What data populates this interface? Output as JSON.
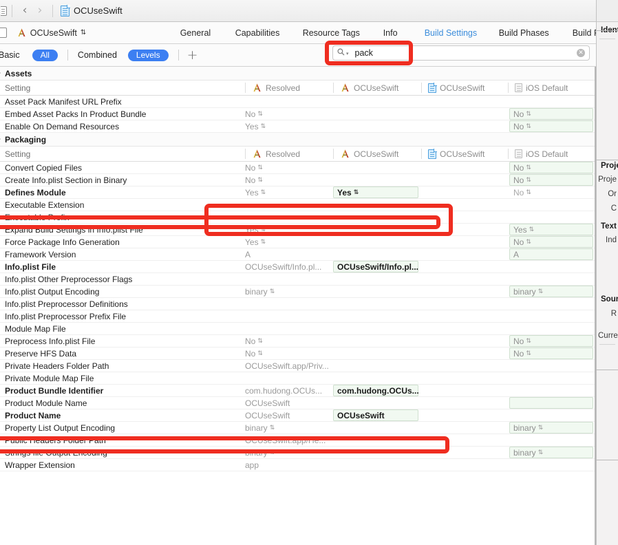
{
  "window": {
    "breadcrumb_project": "OCUseSwift",
    "back_arrow": "‹",
    "forward_arrow": "›"
  },
  "tabbar": {
    "target_name": "OCUseSwift",
    "stepper": "⇅",
    "tabs": [
      {
        "label": "General",
        "active": false
      },
      {
        "label": "Capabilities",
        "active": false
      },
      {
        "label": "Resource Tags",
        "active": false
      },
      {
        "label": "Info",
        "active": false
      },
      {
        "label": "Build Settings",
        "active": true
      },
      {
        "label": "Build Phases",
        "active": false
      },
      {
        "label": "Build Rules",
        "active": false
      }
    ]
  },
  "filterbar": {
    "basic": "Basic",
    "all": "All",
    "combined": "Combined",
    "levels": "Levels",
    "plus": "+"
  },
  "search": {
    "glyph": "⚲",
    "caret": "▾",
    "value": "pack",
    "placeholder": "",
    "clear": "✕"
  },
  "columns": {
    "setting": "Setting",
    "resolved": "Resolved",
    "target": "OCUseSwift",
    "project": "OCUseSwift",
    "ios_default": "iOS Default"
  },
  "groups": [
    {
      "title": "Assets",
      "rows": [
        {
          "name": "Asset Pack Manifest URL Prefix",
          "bold": false,
          "resolved": "",
          "resolved_stepper": false,
          "target": "",
          "project": "",
          "default": "",
          "default_field": false,
          "default_stepper": false
        },
        {
          "name": "Embed Asset Packs In Product Bundle",
          "bold": false,
          "resolved": "No",
          "resolved_stepper": true,
          "target": "",
          "project": "",
          "default": "No",
          "default_field": true,
          "default_stepper": true
        },
        {
          "name": "Enable On Demand Resources",
          "bold": false,
          "resolved": "Yes",
          "resolved_stepper": true,
          "target": "",
          "project": "",
          "default": "No",
          "default_field": true,
          "default_stepper": true
        }
      ]
    },
    {
      "title": "Packaging",
      "rows": [
        {
          "name": "Convert Copied Files",
          "bold": false,
          "resolved": "No",
          "resolved_stepper": true,
          "target": "",
          "project": "",
          "default": "No",
          "default_field": true,
          "default_stepper": true
        },
        {
          "name": "Create Info.plist Section in Binary",
          "bold": false,
          "resolved": "No",
          "resolved_stepper": true,
          "target": "",
          "project": "",
          "default": "No",
          "default_field": true,
          "default_stepper": true
        },
        {
          "name": "Defines Module",
          "bold": true,
          "resolved": "Yes",
          "resolved_stepper": true,
          "target": "Yes",
          "target_stepper": true,
          "target_field": true,
          "project": "",
          "default": "No",
          "default_field": false,
          "default_stepper": true
        },
        {
          "name": "Executable Extension",
          "bold": false,
          "resolved": "",
          "resolved_stepper": false,
          "target": "",
          "project": "",
          "default": "",
          "default_field": false,
          "default_stepper": false
        },
        {
          "name": "Executable Prefix",
          "bold": false,
          "resolved": "",
          "resolved_stepper": false,
          "target": "",
          "project": "",
          "default": "",
          "default_field": false,
          "default_stepper": false
        },
        {
          "name": "Expand Build Settings in Info.plist File",
          "bold": false,
          "resolved": "Yes",
          "resolved_stepper": true,
          "target": "",
          "project": "",
          "default": "Yes",
          "default_field": true,
          "default_stepper": true
        },
        {
          "name": "Force Package Info Generation",
          "bold": false,
          "resolved": "Yes",
          "resolved_stepper": true,
          "target": "",
          "project": "",
          "default": "No",
          "default_field": true,
          "default_stepper": true
        },
        {
          "name": "Framework Version",
          "bold": false,
          "resolved": "A",
          "resolved_stepper": false,
          "target": "",
          "project": "",
          "default": "A",
          "default_field": true,
          "default_stepper": false
        },
        {
          "name": "Info.plist File",
          "bold": true,
          "resolved": "OCUseSwift/Info.pl...",
          "resolved_stepper": false,
          "target": "OCUseSwift/Info.pl...",
          "target_field": true,
          "target_stepper": false,
          "project": "",
          "default": "",
          "default_field": false,
          "default_stepper": false
        },
        {
          "name": "Info.plist Other Preprocessor Flags",
          "bold": false,
          "resolved": "",
          "resolved_stepper": false,
          "target": "",
          "project": "",
          "default": "",
          "default_field": false,
          "default_stepper": false
        },
        {
          "name": "Info.plist Output Encoding",
          "bold": false,
          "resolved": "binary",
          "resolved_stepper": true,
          "target": "",
          "project": "",
          "default": "binary",
          "default_field": true,
          "default_stepper": true
        },
        {
          "name": "Info.plist Preprocessor Definitions",
          "bold": false,
          "resolved": "",
          "resolved_stepper": false,
          "target": "",
          "project": "",
          "default": "",
          "default_field": false,
          "default_stepper": false
        },
        {
          "name": "Info.plist Preprocessor Prefix File",
          "bold": false,
          "resolved": "",
          "resolved_stepper": false,
          "target": "",
          "project": "",
          "default": "",
          "default_field": false,
          "default_stepper": false
        },
        {
          "name": "Module Map File",
          "bold": false,
          "resolved": "",
          "resolved_stepper": false,
          "target": "",
          "project": "",
          "default": "",
          "default_field": false,
          "default_stepper": false
        },
        {
          "name": "Preprocess Info.plist File",
          "bold": false,
          "resolved": "No",
          "resolved_stepper": true,
          "target": "",
          "project": "",
          "default": "No",
          "default_field": true,
          "default_stepper": true
        },
        {
          "name": "Preserve HFS Data",
          "bold": false,
          "resolved": "No",
          "resolved_stepper": true,
          "target": "",
          "project": "",
          "default": "No",
          "default_field": true,
          "default_stepper": true
        },
        {
          "name": "Private Headers Folder Path",
          "bold": false,
          "resolved": "OCUseSwift.app/Priv...",
          "resolved_stepper": false,
          "target": "",
          "project": "",
          "default": "",
          "default_field": false,
          "default_stepper": false
        },
        {
          "name": "Private Module Map File",
          "bold": false,
          "resolved": "",
          "resolved_stepper": false,
          "target": "",
          "project": "",
          "default": "",
          "default_field": false,
          "default_stepper": false
        },
        {
          "name": "Product Bundle Identifier",
          "bold": true,
          "resolved": "com.hudong.OCUs...",
          "resolved_stepper": false,
          "target": "com.hudong.OCUs...",
          "target_field": true,
          "target_stepper": false,
          "project": "",
          "default": "",
          "default_field": false,
          "default_stepper": false
        },
        {
          "name": "Product Module Name",
          "bold": false,
          "resolved": "OCUseSwift",
          "resolved_stepper": false,
          "target": "",
          "project": "",
          "default": "",
          "default_field": true,
          "default_stepper": false
        },
        {
          "name": "Product Name",
          "bold": true,
          "resolved": "OCUseSwift",
          "resolved_stepper": false,
          "target": "OCUseSwift",
          "target_field": true,
          "target_stepper": false,
          "project": "",
          "default": "",
          "default_field": false,
          "default_stepper": false
        },
        {
          "name": "Property List Output Encoding",
          "bold": false,
          "resolved": "binary",
          "resolved_stepper": true,
          "target": "",
          "project": "",
          "default": "binary",
          "default_field": true,
          "default_stepper": true
        },
        {
          "name": "Public Headers Folder Path",
          "bold": false,
          "resolved": "OCUseSwift.app/He...",
          "resolved_stepper": false,
          "target": "",
          "project": "",
          "default": "",
          "default_field": false,
          "default_stepper": false
        },
        {
          "name": "Strings file Output Encoding",
          "bold": false,
          "resolved": "binary",
          "resolved_stepper": true,
          "target": "",
          "project": "",
          "default": "binary",
          "default_field": true,
          "default_stepper": true
        },
        {
          "name": "Wrapper Extension",
          "bold": false,
          "resolved": "app",
          "resolved_stepper": false,
          "target": "",
          "project": "",
          "default": "",
          "default_field": false,
          "default_stepper": false
        }
      ]
    }
  ],
  "inspector": {
    "identity": "Ident",
    "project_section": "Proje",
    "project_label": "Proje",
    "org_label": "Or",
    "class_label": "C",
    "text_section": "Text",
    "indent_label": "Ind",
    "source_section": "Sour",
    "source_label": "R",
    "current_label": "Curre"
  },
  "annotations": {
    "search_highlight": "search-field-highlight",
    "defines_module_highlight": "defines-module-highlight",
    "defines_module_value_highlight": "defines-module-value-highlight",
    "product_name_highlight": "product-name-highlight"
  },
  "colors": {
    "accent_blue": "#3c7ff2",
    "tab_active": "#3c8ddb",
    "annotation_red": "#ef2d20",
    "field_green_bg": "#f1f9f1",
    "field_green_border": "#cfe0cf"
  }
}
